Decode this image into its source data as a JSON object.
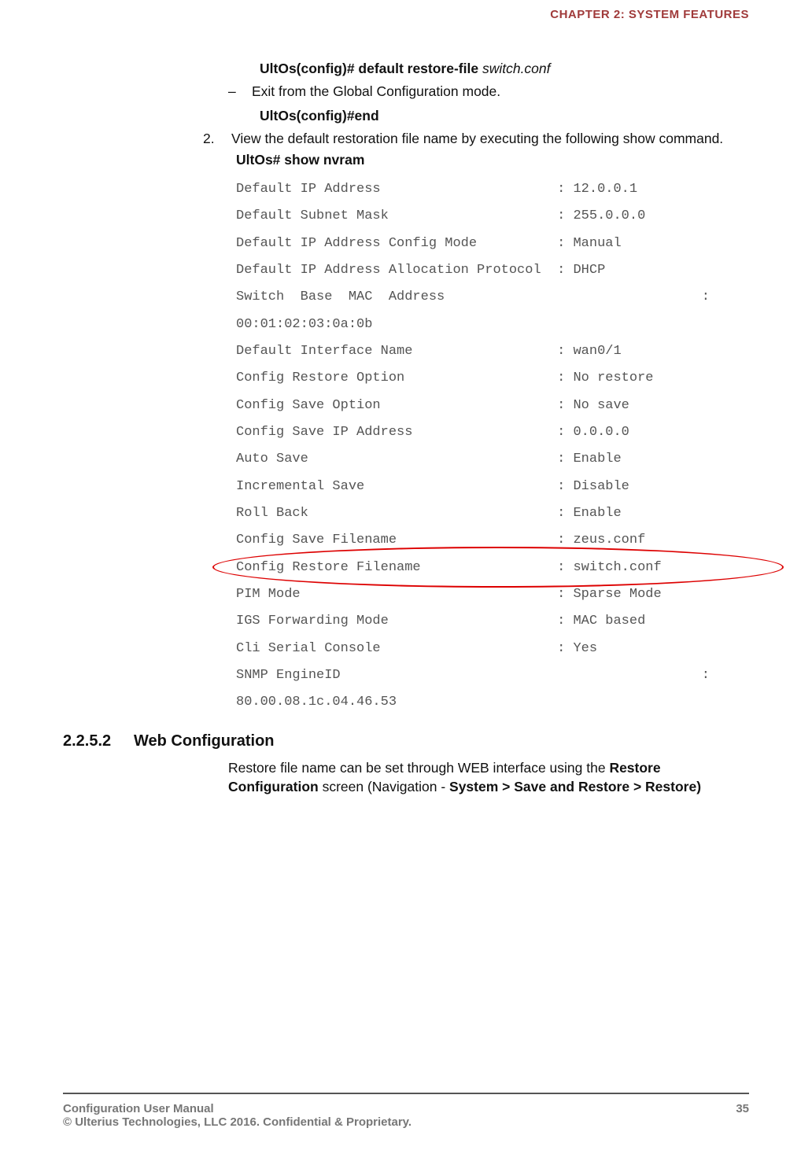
{
  "header": {
    "chapter": "CHAPTER 2: SYSTEM FEATURES"
  },
  "body": {
    "cmd1_prompt": "UltOs(config)# default restore-file ",
    "cmd1_arg": "switch.conf",
    "dash1_text": "Exit from the Global Configuration mode.",
    "cmd2": "UltOs(config)#end",
    "step2_num": "2.",
    "step2_text": "View the default restoration file name by executing the following show command.",
    "cmd3": "UltOs# show nvram",
    "nvram": [
      {
        "k": "Default IP Address",
        "v": "12.0.0.1",
        "hl": false
      },
      {
        "k": "Default Subnet Mask",
        "v": "255.0.0.0",
        "hl": false
      },
      {
        "k": "Default IP Address Config Mode",
        "v": "Manual",
        "hl": false
      },
      {
        "k": "Default IP Address Allocation Protocol",
        "v": "DHCP",
        "hl": false
      },
      {
        "k": "Switch  Base  MAC  Address",
        "v": "00:01:02:03:0a:0b",
        "wrap": true,
        "hl": false
      },
      {
        "k": "Default Interface Name",
        "v": "wan0/1",
        "hl": false
      },
      {
        "k": "Config Restore Option",
        "v": "No restore",
        "hl": false
      },
      {
        "k": "Config Save Option",
        "v": "No save",
        "hl": false
      },
      {
        "k": "Config Save IP Address",
        "v": "0.0.0.0",
        "hl": false
      },
      {
        "k": "Auto Save",
        "v": "Enable",
        "hl": false
      },
      {
        "k": "Incremental Save",
        "v": "Disable",
        "hl": false
      },
      {
        "k": "Roll Back",
        "v": "Enable",
        "hl": false
      },
      {
        "k": "Config Save Filename",
        "v": "zeus.conf",
        "hl": false
      },
      {
        "k": "Config Restore Filename",
        "v": "switch.conf",
        "hl": true
      },
      {
        "k": "PIM Mode",
        "v": "Sparse Mode",
        "hl": false
      },
      {
        "k": "IGS Forwarding Mode",
        "v": "MAC based",
        "hl": false
      },
      {
        "k": "Cli Serial Console",
        "v": "Yes",
        "hl": false
      },
      {
        "k": "SNMP EngineID",
        "v": "80.00.08.1c.04.46.53",
        "wrap": true,
        "hl": false
      }
    ]
  },
  "section": {
    "num": "2.2.5.2",
    "title": "Web Configuration",
    "para_pre": "Restore file name can be set through WEB interface using the ",
    "para_b1": "Restore Configuration",
    "para_mid": " screen (Navigation - ",
    "para_b2": "System > Save and Restore > Restore)"
  },
  "footer": {
    "left1": "Configuration User Manual",
    "left2": "© Ulterius Technologies, LLC 2016. Confidential & Proprietary.",
    "right": "35"
  }
}
